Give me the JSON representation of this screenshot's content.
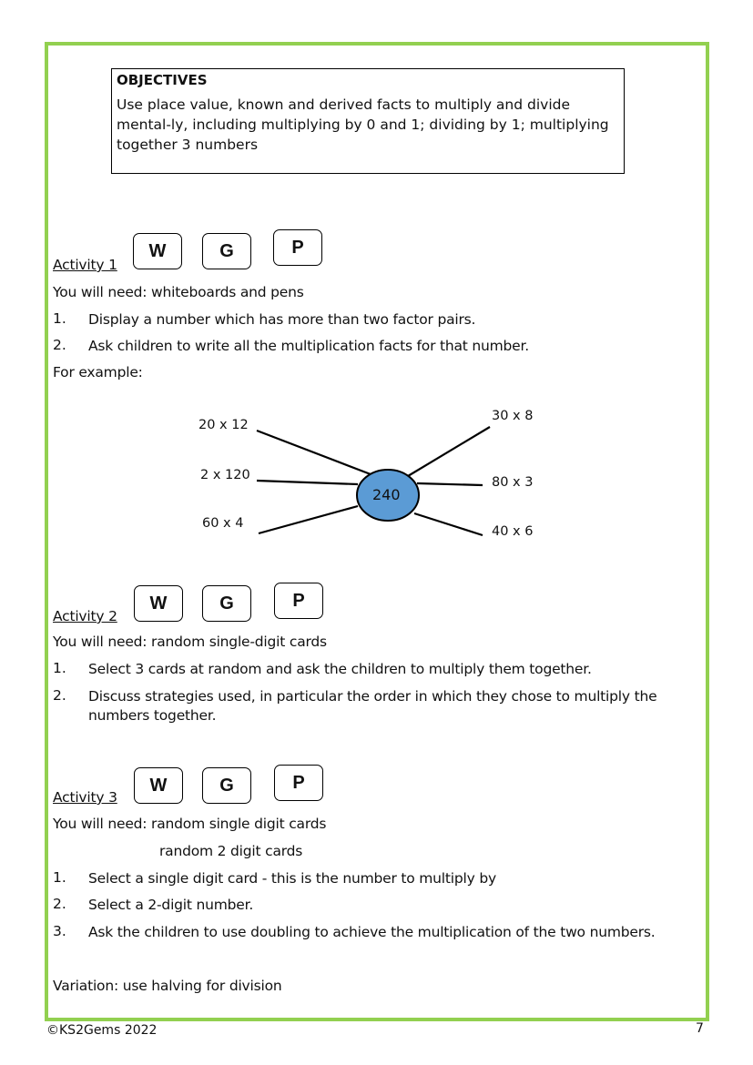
{
  "objectives": {
    "title": "OBJECTIVES",
    "text": "Use place value, known and derived facts to multiply and divide mental-ly, including multiplying by 0 and 1; dividing by 1; multiplying together 3 numbers"
  },
  "badges": [
    "W",
    "G",
    "P"
  ],
  "activity1": {
    "title": "Activity 1",
    "need": "You will need:   whiteboards and pens",
    "steps": [
      {
        "num": "1.",
        "text": "Display a number which has more than two factor pairs."
      },
      {
        "num": "2.",
        "text": "Ask children to write all the multiplication facts for that number."
      }
    ],
    "example_label": "For example:"
  },
  "diagram": {
    "center": "240",
    "center_color": "#5B9BD5",
    "left_labels": [
      "20 x 12",
      "2 x 120",
      "60 x 4"
    ],
    "right_labels": [
      "30 x 8",
      "80 x 3",
      "40 x 6"
    ]
  },
  "activity2": {
    "title": "Activity 2",
    "need": "You will need: random single-digit cards",
    "steps": [
      {
        "num": "1.",
        "text": "Select 3 cards at random and ask the children to multiply them together."
      },
      {
        "num": "2.",
        "text": "Discuss strategies used, in particular the order in which they chose to multiply the",
        "text2": "numbers together."
      }
    ]
  },
  "activity3": {
    "title": "Activity 3",
    "need": "You will need: random single digit cards",
    "need2": "random 2 digit cards",
    "steps": [
      {
        "num": "1.",
        "text": "Select a single digit card - this is the number to multiply by"
      },
      {
        "num": "2.",
        "text": "Select a 2-digit number."
      },
      {
        "num": "3.",
        "text": "Ask the children to use doubling to achieve the multiplication of the two numbers."
      }
    ],
    "variation": "Variation: use halving for division"
  },
  "footer": {
    "copyright": "©KS2Gems 2022",
    "page_number": "7"
  },
  "colors": {
    "frame": "#92D050"
  }
}
